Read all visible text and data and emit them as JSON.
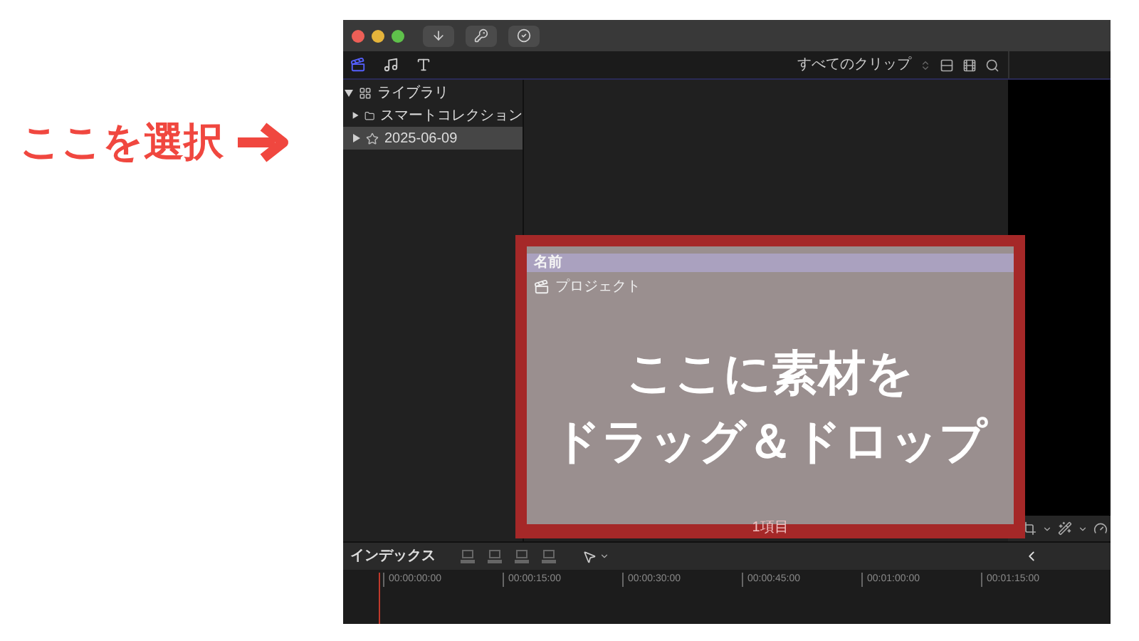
{
  "annotation": {
    "text": "ここを選択"
  },
  "toolbar": {
    "filter": "すべてのクリップ"
  },
  "sidebar": {
    "items": [
      {
        "kind": "library",
        "label": "ライブラリ",
        "expanded": true,
        "selected": false,
        "children": [
          {
            "kind": "folder",
            "label": "スマートコレクション",
            "expanded": false,
            "selected": false
          },
          {
            "kind": "event",
            "label": "2025-06-09",
            "expanded": false,
            "selected": true
          }
        ]
      }
    ]
  },
  "browser": {
    "column_header": "名前",
    "rows": [
      {
        "label": "プロジェクト"
      }
    ],
    "footer": "1項目"
  },
  "overlay": {
    "lines": [
      "ここに素材を",
      "ドラッグ＆ドロップ"
    ]
  },
  "timeline": {
    "index_label": "インデックス",
    "timecodes": [
      "00:00:00:00",
      "00:00:15:00",
      "00:00:30:00",
      "00:00:45:00",
      "00:01:00:00",
      "00:01:15:00"
    ]
  }
}
